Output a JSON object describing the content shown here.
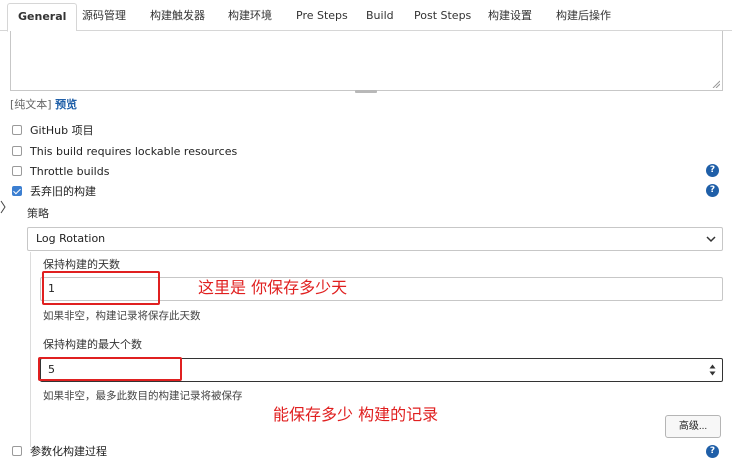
{
  "tabs": [
    {
      "label": "General",
      "active": true
    },
    {
      "label": "源码管理",
      "active": false
    },
    {
      "label": "构建触发器",
      "active": false
    },
    {
      "label": "构建环境",
      "active": false
    },
    {
      "label": "Pre Steps",
      "active": false
    },
    {
      "label": "Build",
      "active": false
    },
    {
      "label": "Post Steps",
      "active": false
    },
    {
      "label": "构建设置",
      "active": false
    },
    {
      "label": "构建后操作",
      "active": false
    }
  ],
  "description": {
    "value": "",
    "plain_text_label": "[纯文本]",
    "preview_link": "预览"
  },
  "options": [
    {
      "label": "GitHub 项目",
      "checked": false,
      "help": false
    },
    {
      "label": "This build requires lockable resources",
      "checked": false,
      "help": false
    },
    {
      "label": "Throttle builds",
      "checked": false,
      "help": true
    },
    {
      "label": "丢弃旧的构建",
      "checked": true,
      "help": true
    }
  ],
  "discard": {
    "strategy_label": "策略",
    "strategy_value": "Log Rotation",
    "days_label": "保持构建的天数",
    "days_value": "1",
    "days_hint": "如果非空，构建记录将保存此天数",
    "max_label": "保持构建的最大个数",
    "max_value": "5",
    "max_hint": "如果非空，最多此数目的构建记录将被保存",
    "advanced_button": "高级..."
  },
  "parameterized": {
    "label": "参数化构建过程",
    "checked": false,
    "help": true
  },
  "annotations": {
    "days_note": "这里是 你保存多少天",
    "max_note": "能保存多少 构建的记录"
  },
  "colors": {
    "accent": "#1f5fa8",
    "annotation": "#e02020",
    "checkbox_checked": "#3c7fd1"
  }
}
